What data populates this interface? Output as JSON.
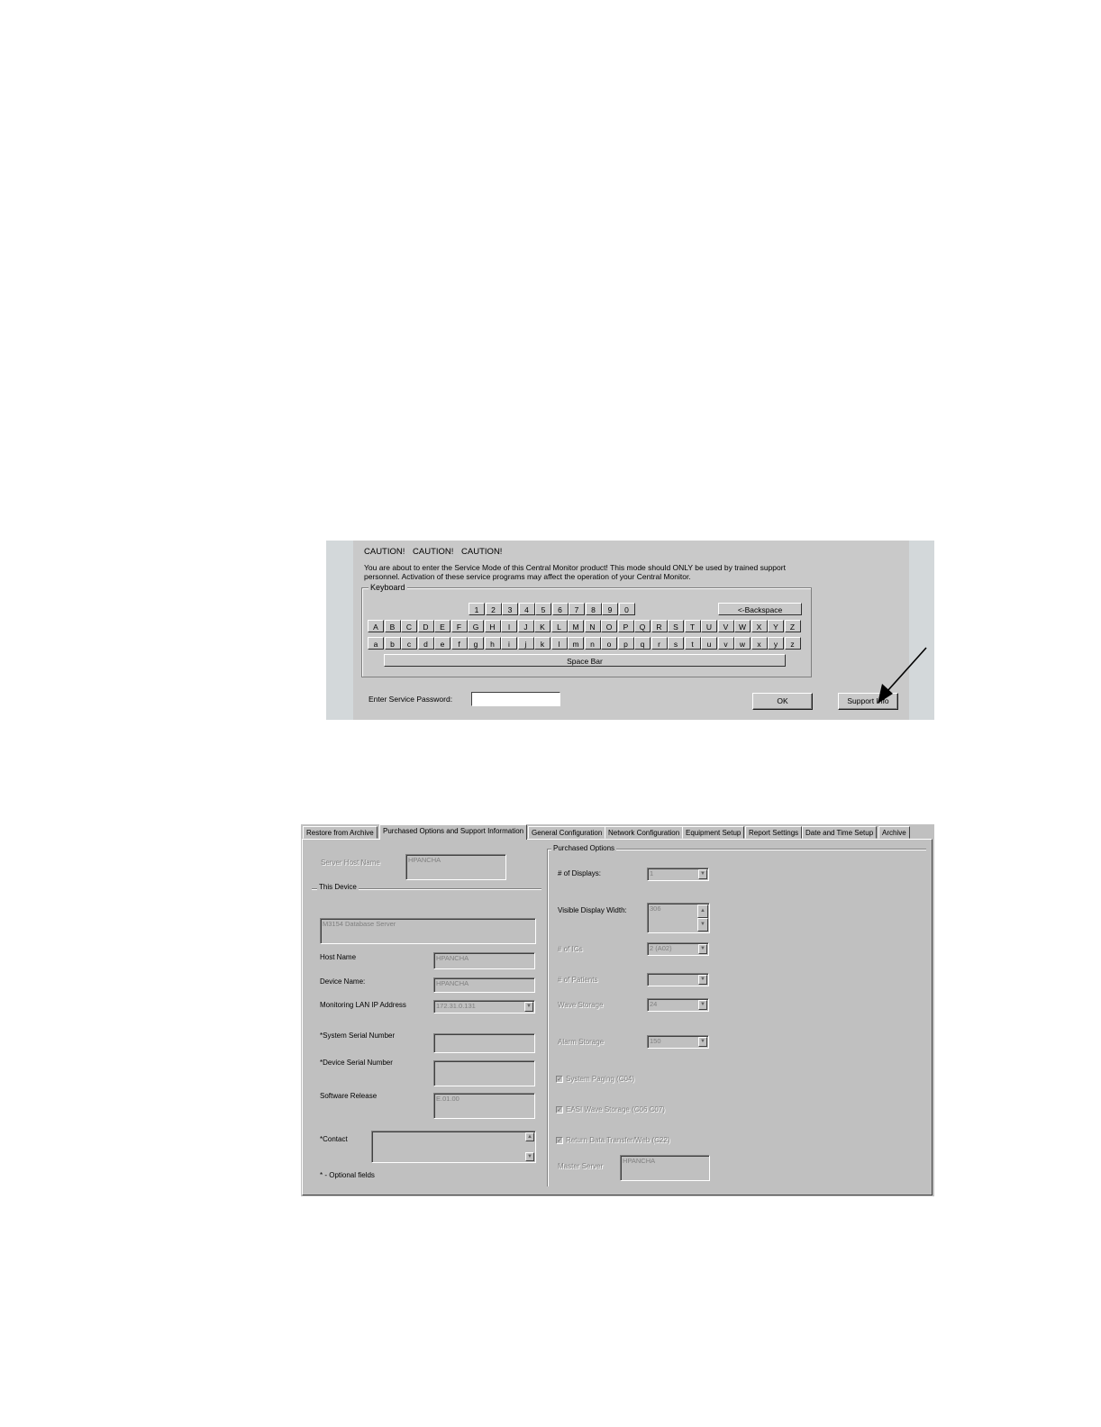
{
  "service_dialog": {
    "caution": "CAUTION!   CAUTION!   CAUTION!",
    "message": "You are about to enter the Service Mode of this Central Monitor product!  This mode should ONLY be used by trained support personnel.  Activation of these service programs may affect the operation of your Central Monitor.",
    "keyboard_label": "Keyboard",
    "digits": [
      "1",
      "2",
      "3",
      "4",
      "5",
      "6",
      "7",
      "8",
      "9",
      "0"
    ],
    "backspace": "<-Backspace",
    "upper": [
      "A",
      "B",
      "C",
      "D",
      "E",
      "F",
      "G",
      "H",
      "I",
      "J",
      "K",
      "L",
      "M",
      "N",
      "O",
      "P",
      "Q",
      "R",
      "S",
      "T",
      "U",
      "V",
      "W",
      "X",
      "Y",
      "Z"
    ],
    "lower": [
      "a",
      "b",
      "c",
      "d",
      "e",
      "f",
      "g",
      "h",
      "i",
      "j",
      "k",
      "l",
      "m",
      "n",
      "o",
      "p",
      "q",
      "r",
      "s",
      "t",
      "u",
      "v",
      "w",
      "x",
      "y",
      "z"
    ],
    "space_bar": "Space Bar",
    "password_label": "Enter Service Password:",
    "password_value": "",
    "ok": "OK",
    "support_info": "Support Info"
  },
  "config_window": {
    "tabs": [
      {
        "label": "Restore from Archive"
      },
      {
        "label": "Purchased Options and Support Information"
      },
      {
        "label": "General Configuration"
      },
      {
        "label": "Network Configuration"
      },
      {
        "label": "Equipment Setup"
      },
      {
        "label": "Report Settings"
      },
      {
        "label": "Date and Time Setup"
      },
      {
        "label": "Archive"
      }
    ],
    "left": {
      "server_host_label": "Server Host Name",
      "server_host_value": "HPANCHA",
      "this_device": "This Device",
      "device_desc": "M3154 Database Server",
      "host_name_label": "Host Name",
      "host_name_value": "HPANCHA",
      "device_name_label": "Device Name:",
      "device_name_value": "HPANCHA",
      "lan_ip_label": "Monitoring LAN IP Address",
      "lan_ip_value": "172.31.0.131",
      "sys_serial_label": "*System Serial Number",
      "dev_serial_label": "*Device Serial Number",
      "sw_release_label": "Software Release",
      "sw_release_value": "E.01.00",
      "contact_label": "*Contact",
      "optional_note": "* - Optional fields"
    },
    "right": {
      "group_label": "Purchased Options",
      "displays_label": "# of Displays:",
      "displays_value": "1",
      "width_label": "Visible Display Width:",
      "width_value": "306",
      "ic_label": "# of ICs",
      "ic_value": "2 (A02)",
      "patients_label": "# of Patients",
      "patients_value": "",
      "wave_label": "Wave Storage",
      "wave_value": "24",
      "alarm_label": "Alarm Storage",
      "alarm_value": "150",
      "paging_label": "System Paging (C04)",
      "easy_label": "EASI Wave Storage (C06 C07)",
      "return_label": "Return Data Transfer/Web (C22)",
      "master_label": "Master Server",
      "master_value": "HPANCHA"
    }
  }
}
